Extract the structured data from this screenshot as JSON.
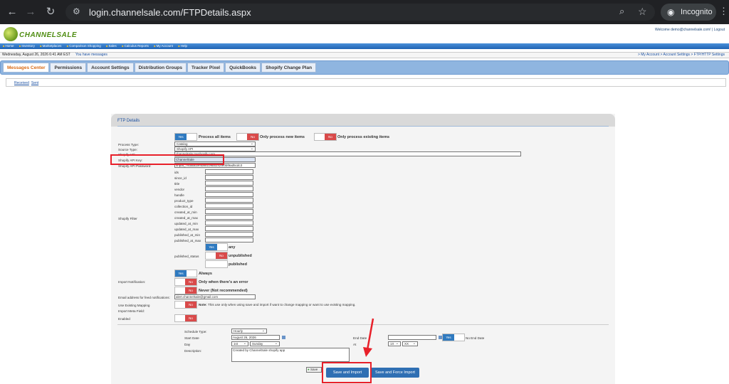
{
  "browser": {
    "url": "login.channelsale.com/FTPDetails.aspx",
    "incognito_label": "Incognito"
  },
  "app": {
    "logo_text": "CHANNELSALE",
    "welcome": "Welcome demo@channelsale.com!",
    "logout": "Logout"
  },
  "menu": [
    "Home",
    "Inventory",
    "Marketplaces",
    "Comparison Shopping",
    "Sales",
    "Calculus Reports",
    "My Account",
    "Help"
  ],
  "infobar": {
    "date": "Wednesday, August 26, 2026 6:41 AM EST",
    "message_link": "You have messages",
    "breadcrumb": "> My Account > Account Settings > FTP/HTTP Settings"
  },
  "tabs": [
    "Messages Center",
    "Permissions",
    "Account Settings",
    "Distribution Groups",
    "Tracker Pixel",
    "QuickBooks",
    "Shopify Change Plan"
  ],
  "subnav": [
    "Received",
    "Sent"
  ],
  "form": {
    "title": "FTP Details",
    "toggle_yes": "Yes",
    "toggle_no": "No",
    "process_all": "Process all items",
    "process_new": "Only process new items",
    "process_existing": "Only process existing items",
    "process_type_label": "Process Type:",
    "process_type_value": "Catalog",
    "source_type_label": "Source Type:",
    "source_type_value": "Shopify API",
    "shopify_url_label": "Shopify Url:",
    "shopify_url_value": "channelsale.myshopify.com",
    "api_key_label": "Shopify API Key:",
    "api_key_value": "ChannelSale",
    "api_password_label": "Shopify API Password:",
    "api_password_value": "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3",
    "shopify_filter_label": "Shopify Filter",
    "filters": [
      "ids",
      "since_id",
      "title",
      "vendor",
      "handle",
      "product_type",
      "collection_id",
      "created_at_min",
      "created_at_max",
      "updated_at_min",
      "updated_at_max",
      "published_at_min",
      "published_at_max"
    ],
    "published_status_label": "published_status",
    "status_any": "any",
    "status_unpublished": "unpublished",
    "status_published": "published",
    "import_notification_label": "Import Notification:",
    "notify_always": "Always",
    "notify_error": "Only when there's an error",
    "notify_never": "Never (Not recommended)",
    "email_label": "Email address for feed notifications:",
    "email_value": "alert.channelsale@gmail.com",
    "existing_mapping_label": "Use Existing Mapping",
    "mapping_note_bold": "Note:",
    "mapping_note": "This use only when using save and import if want to change mapping or want to use existing mapping.",
    "import_meta_label": "Import Meta Field:",
    "enabled_label": "Enabled",
    "schedule_type_label": "Schedule Type:",
    "schedule_type_value": "Hourly",
    "start_date_label": "Start Date",
    "start_date_value": "August 26, 2026",
    "end_date_label": "End Date",
    "no_end_date": "No End Date",
    "day_label": "Day",
    "day_value": "1st",
    "weekday_value": "Sunday",
    "at_label": "At",
    "at_hour": "1X",
    "at_minute": "XX",
    "description_label": "Description:",
    "description_value": "Created by ChannelSale shopify app",
    "save_label": "Save",
    "save_import": "Save and Import",
    "save_force_import": "Save and Force Import"
  },
  "colors": {
    "highlight": "#e8202a",
    "toggle_on": "#2f7ac0",
    "toggle_off": "#d94a4a"
  }
}
